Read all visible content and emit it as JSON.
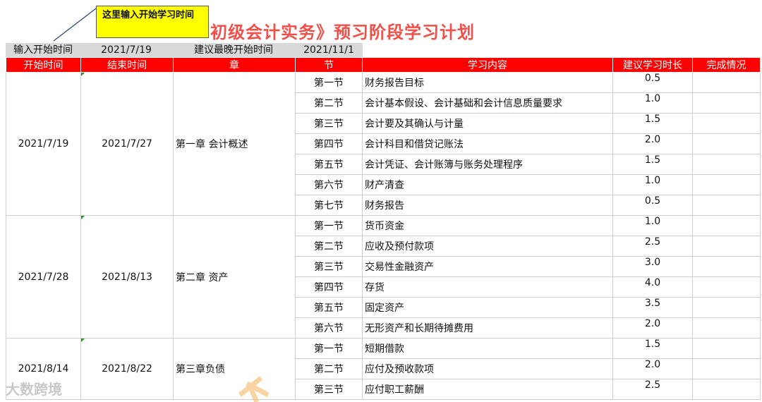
{
  "title": "初级会计实务》预习阶段学习计划",
  "comment": "这里输入开始学习时间",
  "input_bar": {
    "start_label": "输入开始时间",
    "start_value": "2021/7/19",
    "latest_label": "建议最晚开始时间",
    "latest_value": "2021/11/1"
  },
  "headers": [
    "开始时间",
    "结束时间",
    "章",
    "节",
    "学习内容",
    "建议学习时长",
    "完成情况"
  ],
  "chapters": [
    {
      "start": "2021/7/19",
      "end": "2021/7/27",
      "name": "第一章 会计概述",
      "sections": [
        {
          "section": "第一节",
          "content": "财务报告目标",
          "hours": "0.5"
        },
        {
          "section": "第二节",
          "content": "会计基本假设、会计基础和会计信息质量要求",
          "hours": "1.0"
        },
        {
          "section": "第三节",
          "content": "会计要及其确认与计量",
          "hours": "1.5"
        },
        {
          "section": "第四节",
          "content": "会计科目和借贷记账法",
          "hours": "2.0"
        },
        {
          "section": "第五节",
          "content": "会计凭证、会计账簿与账务处理程序",
          "hours": "1.5"
        },
        {
          "section": "第六节",
          "content": "财产清查",
          "hours": "1.0"
        },
        {
          "section": "第七节",
          "content": "财务报告",
          "hours": "0.5"
        }
      ]
    },
    {
      "start": "2021/7/28",
      "end": "2021/8/13",
      "name": "第二章 资产",
      "sections": [
        {
          "section": "第一节",
          "content": "货币资金",
          "hours": "1.0"
        },
        {
          "section": "第二节",
          "content": "应收及预付款项",
          "hours": "2.5"
        },
        {
          "section": "第三节",
          "content": "交易性金融资产",
          "hours": "3.0"
        },
        {
          "section": "第四节",
          "content": "存货",
          "hours": "4.0"
        },
        {
          "section": "第五节",
          "content": "固定资产",
          "hours": "3.5"
        },
        {
          "section": "第六节",
          "content": "无形资产和长期待摊费用",
          "hours": "2.0"
        }
      ]
    },
    {
      "start": "2021/8/14",
      "end": "2021/8/22",
      "name": "第三章负债",
      "sections": [
        {
          "section": "第一节",
          "content": "短期借款",
          "hours": "1.5"
        },
        {
          "section": "第二节",
          "content": "应付及预收款项",
          "hours": "2.0"
        },
        {
          "section": "第三节",
          "content": "应付职工薪酬",
          "hours": "2.5"
        }
      ]
    }
  ],
  "watermark": "大数跨境",
  "colors": {
    "header_bg": "#ff0000",
    "title": "#f0504a",
    "comment_bg": "#ffff00",
    "input_bar_bg": "#d9d9d9"
  }
}
